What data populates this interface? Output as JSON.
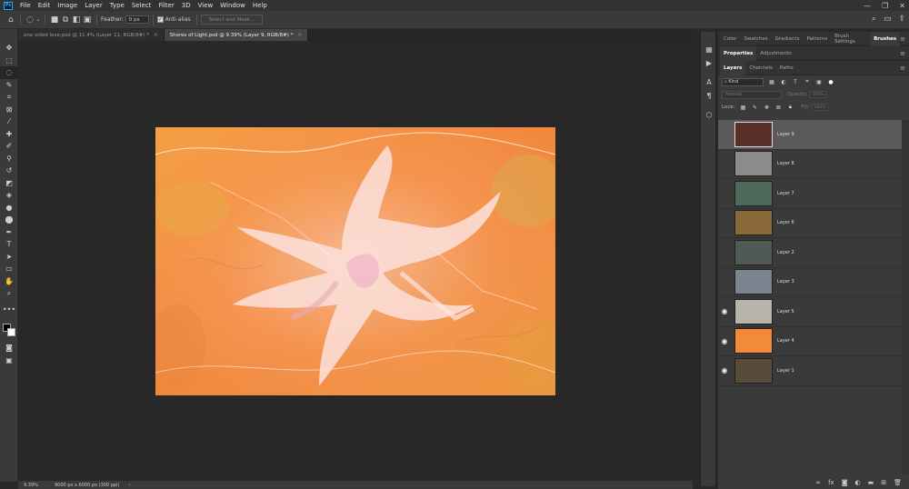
{
  "app": {
    "logo": "Ps"
  },
  "menu": [
    "File",
    "Edit",
    "Image",
    "Layer",
    "Type",
    "Select",
    "Filter",
    "3D",
    "View",
    "Window",
    "Help"
  ],
  "window_controls": [
    "—",
    "❐",
    "✕"
  ],
  "options": {
    "feather_label": "Feather:",
    "feather_value": "0 px",
    "antialias_label": "Anti-alias",
    "select_mask": "Select and Mask..."
  },
  "doc_tabs": [
    {
      "title": "one sided love.psd @ 11.4% (Layer 11, RGB/8#) *",
      "close": "✕"
    },
    {
      "title": "Shores of Light.psd @ 9.39% (Layer 9, RGB/8#) *",
      "close": "✕"
    }
  ],
  "status": {
    "zoom": "9.39%",
    "info": "9000 px x 6000 px (300 ppi)",
    "arrow": "›"
  },
  "panels": {
    "top_tabs": [
      "Color",
      "Swatches",
      "Gradients",
      "Patterns",
      "Brush Settings",
      "Brushes"
    ],
    "props_tabs": [
      "Properties",
      "Adjustments"
    ],
    "layer_tabs": [
      "Layers",
      "Channels",
      "Paths"
    ],
    "menu": "≡",
    "kind": "Kind",
    "blend_mode": "Normal",
    "opacity_label": "Opacity:",
    "opacity_value": "100%",
    "lock_label": "Lock:",
    "fill_label": "Fill:",
    "fill_value": "100%"
  },
  "layers": [
    {
      "name": "Layer 9",
      "visible": false,
      "active": true,
      "thumb": "#5a2f28"
    },
    {
      "name": "Layer 8",
      "visible": false,
      "active": false,
      "thumb": "#8c8c8c"
    },
    {
      "name": "Layer 7",
      "visible": false,
      "active": false,
      "thumb": "#4f6a5a"
    },
    {
      "name": "Layer 6",
      "visible": false,
      "active": false,
      "thumb": "#8a6a3a"
    },
    {
      "name": "Layer 2",
      "visible": false,
      "active": false,
      "thumb": "#505a55"
    },
    {
      "name": "Layer 3",
      "visible": false,
      "active": false,
      "thumb": "#7a8590"
    },
    {
      "name": "Layer 5",
      "visible": true,
      "active": false,
      "thumb": "#b8b4ac"
    },
    {
      "name": "Layer 4",
      "visible": true,
      "active": false,
      "thumb": "#f28a3a"
    },
    {
      "name": "Layer 1",
      "visible": true,
      "active": false,
      "thumb": "#5a4a3a"
    }
  ],
  "colors": {
    "accent": "#31a8ff",
    "canvas_bg": "#282828",
    "panel_bg": "#3a3a3a"
  }
}
